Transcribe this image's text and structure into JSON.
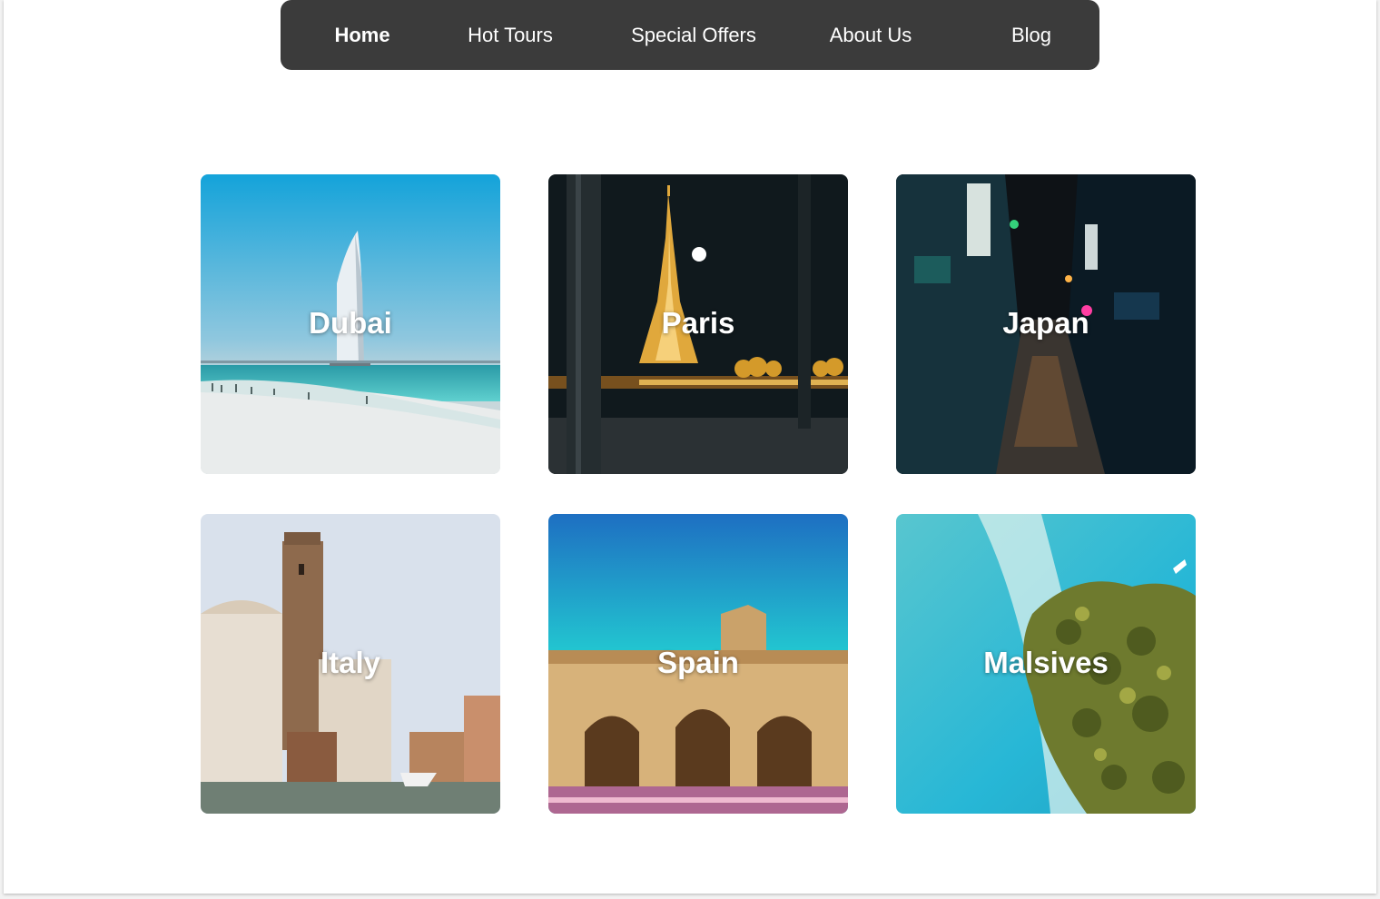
{
  "nav": {
    "items": [
      {
        "label": "Home",
        "active": true
      },
      {
        "label": "Hot Tours",
        "active": false
      },
      {
        "label": "Special Offers",
        "active": false
      },
      {
        "label": "About Us",
        "active": false
      },
      {
        "label": "Blog",
        "active": false
      }
    ],
    "background": "#3b3b3b"
  },
  "destinations": [
    {
      "name": "Dubai"
    },
    {
      "name": "Paris"
    },
    {
      "name": "Japan"
    },
    {
      "name": "Italy"
    },
    {
      "name": "Spain"
    },
    {
      "name": "Malsives"
    }
  ]
}
